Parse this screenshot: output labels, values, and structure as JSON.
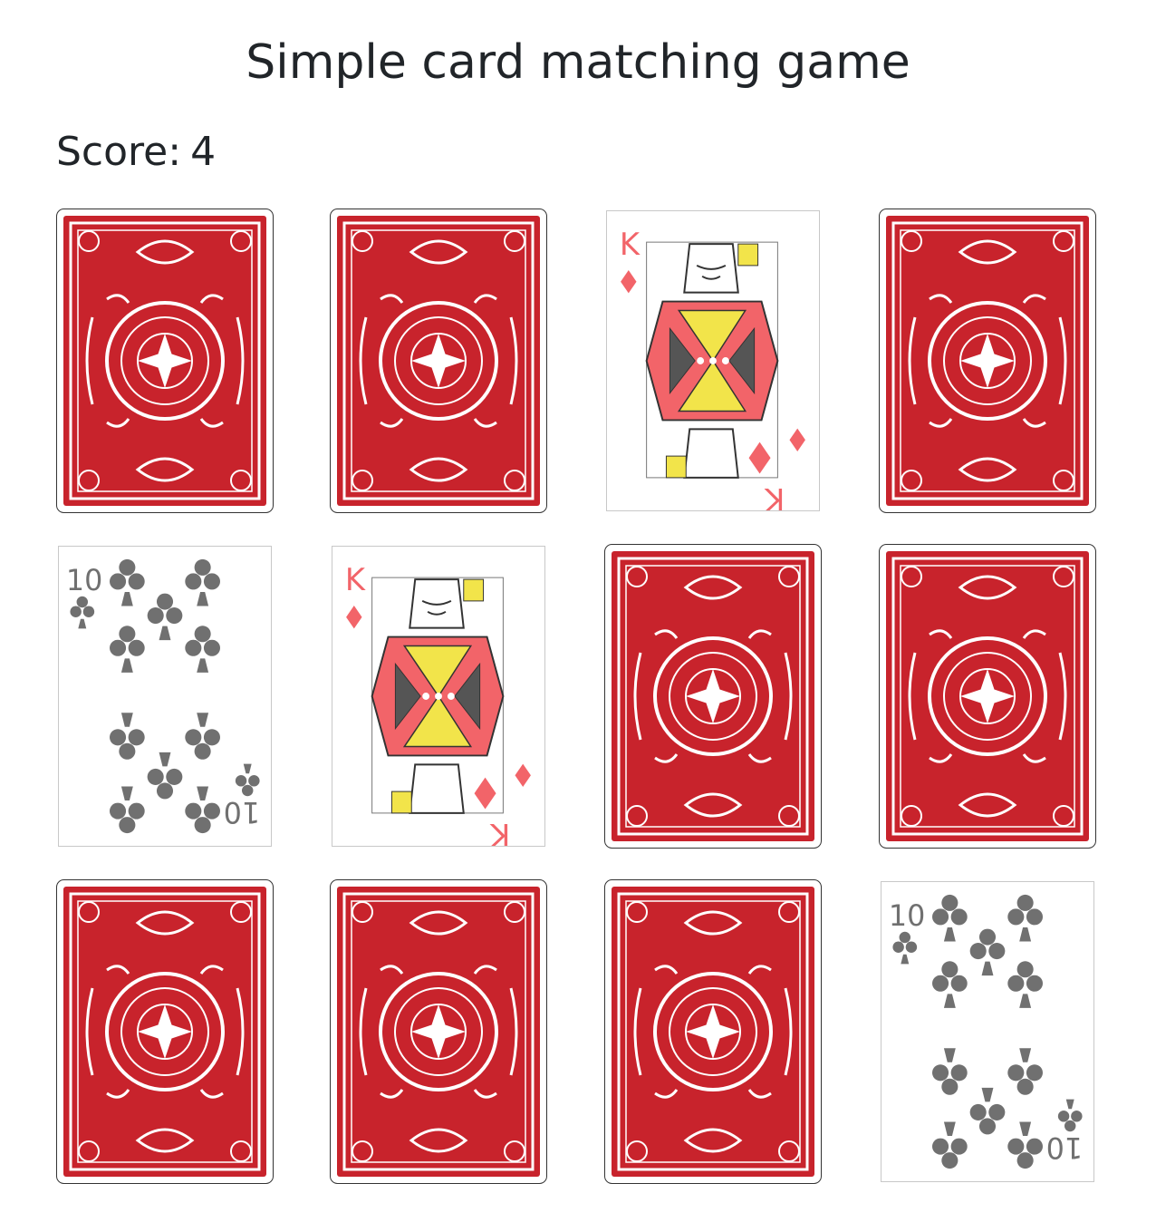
{
  "header": {
    "title": "Simple card matching game"
  },
  "score": {
    "label": "Score:",
    "value": "4"
  },
  "board": {
    "cards": [
      {
        "state": "face-down"
      },
      {
        "state": "face-down"
      },
      {
        "state": "face-up",
        "rank": "K",
        "suit": "diamonds"
      },
      {
        "state": "face-down"
      },
      {
        "state": "face-up",
        "rank": "10",
        "suit": "clubs"
      },
      {
        "state": "face-up",
        "rank": "K",
        "suit": "diamonds"
      },
      {
        "state": "face-down"
      },
      {
        "state": "face-down"
      },
      {
        "state": "face-down"
      },
      {
        "state": "face-down"
      },
      {
        "state": "face-down"
      },
      {
        "state": "face-up",
        "rank": "10",
        "suit": "clubs"
      }
    ]
  },
  "colors": {
    "card_back": "#c8232c",
    "diamond": "#f26469",
    "club": "#707070",
    "text": "#212529"
  }
}
